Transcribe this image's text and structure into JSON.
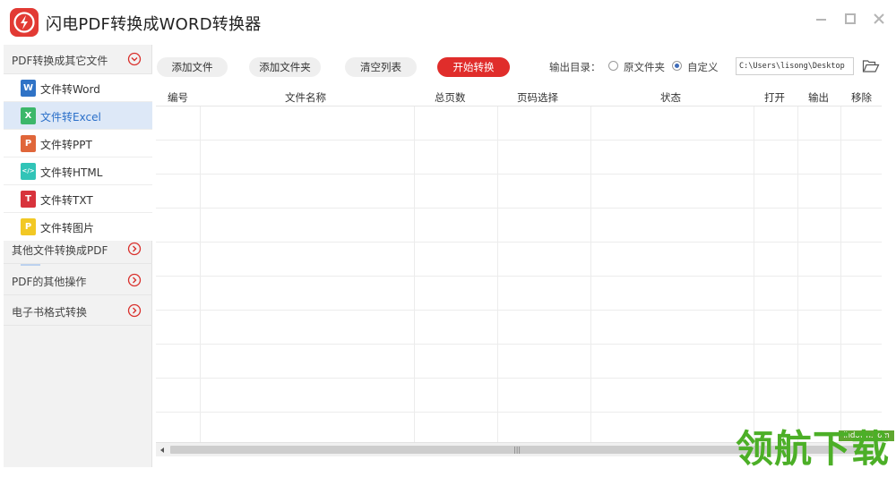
{
  "window": {
    "title": "闪电PDF转换成WORD转换器"
  },
  "sidebar": {
    "categories": [
      {
        "label": "PDF转换成其它文件",
        "expanded": true,
        "items": [
          {
            "label": "文件转Word",
            "icon": "W",
            "color": "#2f73c6"
          },
          {
            "label": "文件转Excel",
            "icon": "X",
            "color": "#3cb76a",
            "active": true
          },
          {
            "label": "文件转PPT",
            "icon": "P",
            "color": "#e0663a"
          },
          {
            "label": "文件转HTML",
            "icon": "</>",
            "color": "#31c4b7"
          },
          {
            "label": "文件转TXT",
            "icon": "T",
            "color": "#d8333c"
          },
          {
            "label": "文件转图片",
            "icon": "P",
            "color": "#f2c824"
          }
        ]
      },
      {
        "label": "其他文件转换成PDF",
        "expanded": false
      },
      {
        "label": "PDF的其他操作",
        "expanded": false
      },
      {
        "label": "电子书格式转换",
        "expanded": false
      }
    ]
  },
  "toolbar": {
    "add_file": "添加文件",
    "add_folder": "添加文件夹",
    "clear_list": "清空列表",
    "start": "开始转换",
    "output_label": "输出目录：",
    "radio_original": "原文件夹",
    "radio_custom": "自定义",
    "selected_output": "自定义",
    "output_path": "C:\\Users\\lisong\\Desktop"
  },
  "table": {
    "columns": [
      "编号",
      "文件名称",
      "总页数",
      "页码选择",
      "状态",
      "打开",
      "输出",
      "移除"
    ],
    "rows": []
  },
  "watermark": {
    "url": "lhdown.com",
    "text": "领航下载"
  },
  "colors": {
    "accent_red": "#e02d2b",
    "active_blue": "#2a6fc9",
    "watermark_green": "#4caf27"
  }
}
